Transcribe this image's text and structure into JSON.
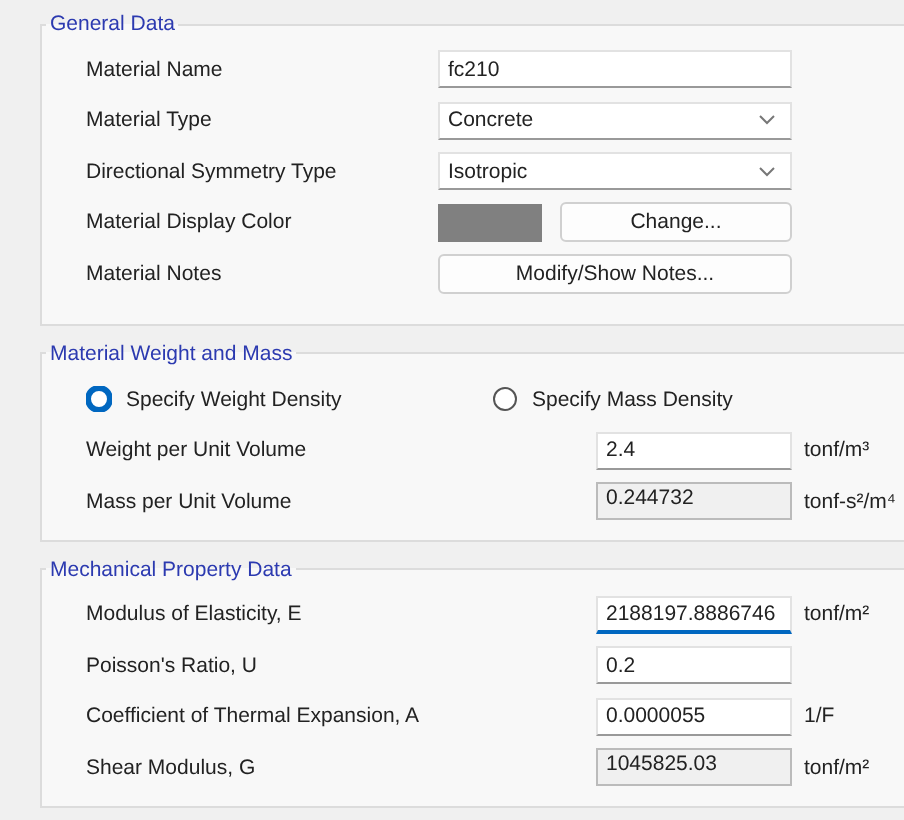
{
  "general_data": {
    "title": "General Data",
    "rows": [
      {
        "label": "Material Name",
        "kind": "text",
        "value": "fc210"
      },
      {
        "label": "Material Type",
        "kind": "select",
        "value": "Concrete"
      },
      {
        "label": "Directional Symmetry Type",
        "kind": "select",
        "value": "Isotropic"
      },
      {
        "label": "Material Display Color",
        "kind": "color",
        "color": "#808080",
        "button": "Change..."
      },
      {
        "label": "Material Notes",
        "kind": "button",
        "button": "Modify/Show Notes..."
      }
    ]
  },
  "weight_and_mass": {
    "title": "Material Weight and Mass",
    "options": [
      {
        "label": "Specify Weight Density",
        "selected": true
      },
      {
        "label": "Specify Mass Density",
        "selected": false
      }
    ],
    "rows": [
      {
        "label": "Weight per Unit Volume",
        "value": "2.4",
        "unit": "tonf/m³",
        "readonly": false,
        "focused": false
      },
      {
        "label": "Mass per Unit Volume",
        "value": "0.244732",
        "unit": "tonf-s²/m⁴",
        "readonly": true,
        "focused": false
      }
    ]
  },
  "mechanical_property_data": {
    "title": "Mechanical Property Data",
    "rows": [
      {
        "label": "Modulus of Elasticity,  E",
        "value": "2188197.8886746",
        "unit": "tonf/m²",
        "readonly": false,
        "focused": true
      },
      {
        "label": "Poisson's Ratio,  U",
        "value": "0.2",
        "readonly": false,
        "focused": false
      },
      {
        "label": "Coefficient of Thermal Expansion,  A",
        "value": "0.0000055",
        "unit": "1/F",
        "readonly": false,
        "focused": false
      },
      {
        "label": "Shear Modulus,  G",
        "value": "1045825.03",
        "unit": "tonf/m²",
        "readonly": true,
        "focused": false
      }
    ]
  }
}
